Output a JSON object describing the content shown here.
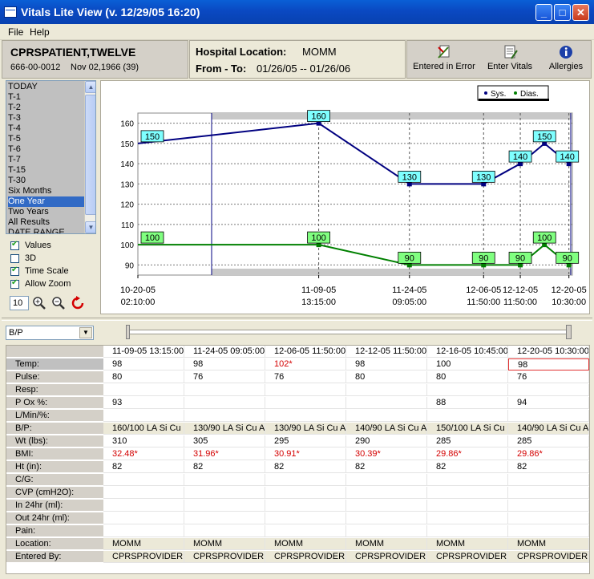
{
  "window": {
    "title": "Vitals Lite View (v. 12/29/05 16:20)"
  },
  "menu": {
    "file": "File",
    "help": "Help"
  },
  "patient": {
    "name": "CPRSPATIENT,TWELVE",
    "ssn": "666-00-0012",
    "dob": "Nov 02,1966 (39)"
  },
  "location": {
    "label": "Hospital Location:",
    "value": "MOMM",
    "range_label": "From - To:",
    "range_value": "01/26/05 -- 01/26/06"
  },
  "toolbar": {
    "entered_in_error": "Entered in Error",
    "enter_vitals": "Enter Vitals",
    "allergies": "Allergies"
  },
  "date_ranges": [
    "TODAY",
    "T-1",
    "T-2",
    "T-3",
    "T-4",
    "T-5",
    "T-6",
    "T-7",
    "T-15",
    "T-30",
    "Six Months",
    "One Year",
    "Two Years",
    "All Results",
    "DATE RANGE"
  ],
  "selected_range": "One Year",
  "options": {
    "values": "Values",
    "three_d": "3D",
    "time_scale": "Time Scale",
    "allow_zoom": "Allow Zoom",
    "zoom_value": "10"
  },
  "options_state": {
    "values": true,
    "three_d": false,
    "time_scale": true,
    "allow_zoom": true
  },
  "vital_select": "B/P",
  "legend": {
    "sys": "Sys.",
    "dias": "Dias."
  },
  "colors": {
    "sys": "#000080",
    "dias": "#008000",
    "sys_label_bg": "#7fffff",
    "dias_label_bg": "#80ff80",
    "title_bar": "#0a49c2",
    "selected": "#316ac5"
  },
  "chart_data": {
    "type": "line",
    "y_ticks": [
      90,
      100,
      110,
      120,
      130,
      140,
      150,
      160
    ],
    "ylim": [
      85,
      165
    ],
    "x_ticks": [
      {
        "date": "10-20-05",
        "time": "02:10:00"
      },
      {
        "date": "11-09-05",
        "time": "13:15:00"
      },
      {
        "date": "11-24-05",
        "time": "09:05:00"
      },
      {
        "date": "12-06-05",
        "time": "11:50:00"
      },
      {
        "date": "12-12-05",
        "time": "11:50:00"
      },
      {
        "date": "12-20-05",
        "time": "10:30:00"
      }
    ],
    "x_domain": [
      "2005-10-11T00:00",
      "2005-12-21T00:00"
    ],
    "series": [
      {
        "name": "Sys.",
        "x": [
          "2005-10-11T00:00",
          "2005-11-09T13:15",
          "2005-11-24T09:05",
          "2005-12-06T11:50",
          "2005-12-12T11:50",
          "2005-12-16T10:45",
          "2005-12-20T10:30"
        ],
        "values": [
          150,
          160,
          130,
          130,
          140,
          150,
          140
        ]
      },
      {
        "name": "Dias.",
        "x": [
          "2005-10-11T00:00",
          "2005-11-09T13:15",
          "2005-11-24T09:05",
          "2005-12-06T11:50",
          "2005-12-12T11:50",
          "2005-12-16T10:45",
          "2005-12-20T10:30"
        ],
        "values": [
          100,
          100,
          90,
          90,
          90,
          100,
          90
        ]
      }
    ]
  },
  "grid": {
    "columns": [
      "11-09-05 13:15:00",
      "11-24-05 09:05:00",
      "12-06-05 11:50:00",
      "12-12-05 11:50:00",
      "12-16-05 10:45:00",
      "12-20-05 10:30:00"
    ],
    "rows": [
      {
        "label": "Temp:",
        "values": [
          "98",
          "98",
          "102*",
          "98",
          "100",
          "98"
        ],
        "red": [
          false,
          false,
          true,
          false,
          false,
          false
        ]
      },
      {
        "label": "Pulse:",
        "values": [
          "80",
          "76",
          "76",
          "80",
          "80",
          "76"
        ]
      },
      {
        "label": "Resp:",
        "values": [
          "",
          "",
          "",
          "",
          "",
          ""
        ]
      },
      {
        "label": "P Ox %:",
        "values": [
          "93",
          "",
          "",
          "",
          "88",
          "94"
        ]
      },
      {
        "label": "L/Min/%:",
        "values": [
          "",
          "",
          "",
          "",
          "",
          ""
        ]
      },
      {
        "label": "B/P:",
        "values": [
          "160/100  LA Si Cu",
          "130/90  LA Si Cu A",
          "130/90  LA Si Cu A",
          "140/90  LA Si Cu A",
          "150/100  LA Si Cu",
          "140/90  LA Si Cu A"
        ]
      },
      {
        "label": "Wt (lbs):",
        "values": [
          "310",
          "305",
          "295",
          "290",
          "285",
          "285"
        ]
      },
      {
        "label": "BMI:",
        "values": [
          "32.48*",
          "31.96*",
          "30.91*",
          "30.39*",
          "29.86*",
          "29.86*"
        ],
        "red": [
          true,
          true,
          true,
          true,
          true,
          true
        ]
      },
      {
        "label": "Ht (in):",
        "values": [
          "82",
          "82",
          "82",
          "82",
          "82",
          "82"
        ]
      },
      {
        "label": "C/G:",
        "values": [
          "",
          "",
          "",
          "",
          "",
          ""
        ]
      },
      {
        "label": "CVP (cmH2O):",
        "values": [
          "",
          "",
          "",
          "",
          "",
          ""
        ]
      },
      {
        "label": "In 24hr (ml):",
        "values": [
          "",
          "",
          "",
          "",
          "",
          ""
        ]
      },
      {
        "label": "Out 24hr (ml):",
        "values": [
          "",
          "",
          "",
          "",
          "",
          ""
        ]
      },
      {
        "label": "Pain:",
        "values": [
          "",
          "",
          "",
          "",
          "",
          ""
        ]
      },
      {
        "label": "Location:",
        "values": [
          "MOMM",
          "MOMM",
          "MOMM",
          "MOMM",
          "MOMM",
          "MOMM"
        ]
      },
      {
        "label": "Entered By:",
        "values": [
          "CPRSPROVIDER,T",
          "CPRSPROVIDER,T",
          "CPRSPROVIDER,T",
          "CPRSPROVIDER,T",
          "CPRSPROVIDER,T",
          "CPRSPROVIDER,T"
        ]
      }
    ]
  }
}
